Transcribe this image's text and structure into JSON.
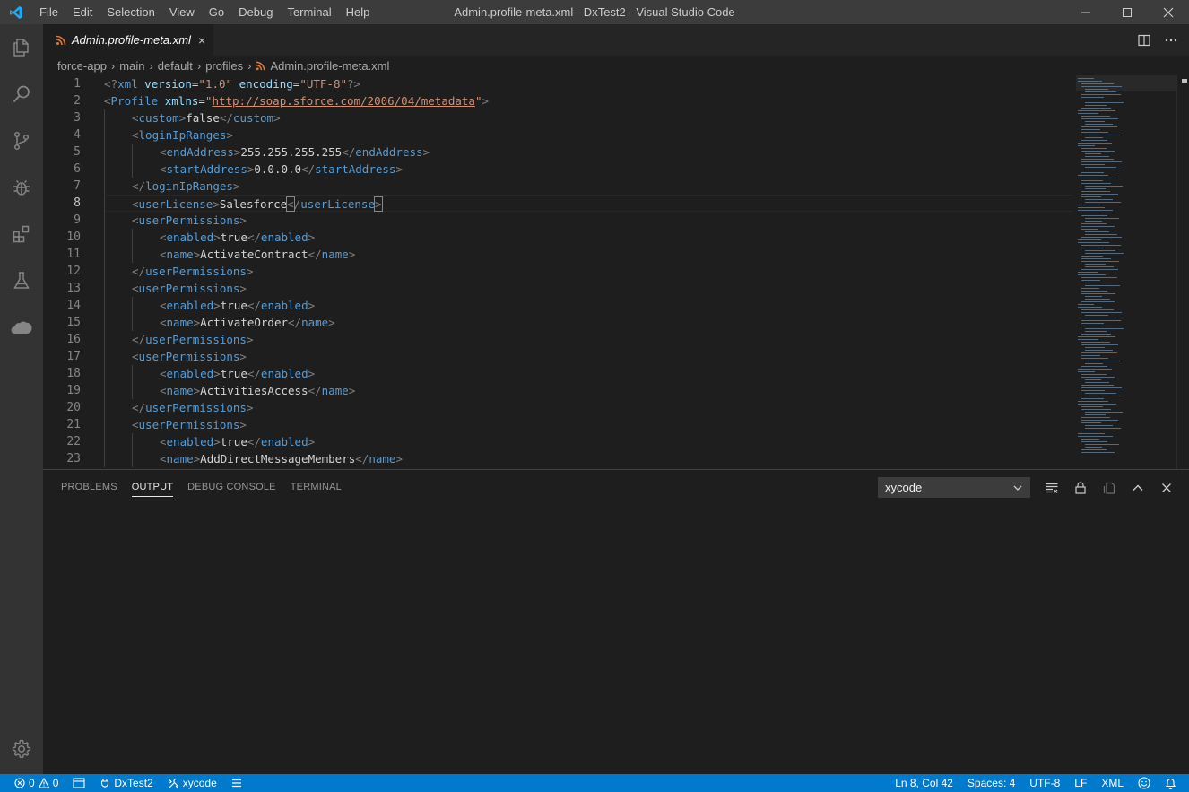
{
  "window": {
    "title": "Admin.profile-meta.xml - DxTest2 - Visual Studio Code",
    "menu": [
      "File",
      "Edit",
      "Selection",
      "View",
      "Go",
      "Debug",
      "Terminal",
      "Help"
    ]
  },
  "activity_bar": {
    "items": [
      "explorer-icon",
      "search-icon",
      "source-control-icon",
      "debug-icon",
      "extensions-icon",
      "test-icon",
      "salesforce-cloud-icon"
    ],
    "bottom": "gear-icon"
  },
  "tab": {
    "name": "Admin.profile-meta.xml",
    "close": "×"
  },
  "breadcrumb": [
    "force-app",
    "main",
    "default",
    "profiles",
    "Admin.profile-meta.xml"
  ],
  "editor": {
    "line_numbers": [
      "1",
      "2",
      "3",
      "4",
      "5",
      "6",
      "7",
      "8",
      "9",
      "10",
      "11",
      "12",
      "13",
      "14",
      "15",
      "16",
      "17",
      "18",
      "19",
      "20",
      "21",
      "22",
      "23"
    ],
    "current_line": 8,
    "lines": [
      {
        "indent": 0,
        "tokens": [
          [
            "punc",
            "<?"
          ],
          [
            "tag",
            "xml"
          ],
          [
            "text",
            " "
          ],
          [
            "attr",
            "version"
          ],
          [
            "text",
            "="
          ],
          [
            "str",
            "\"1.0\""
          ],
          [
            "text",
            " "
          ],
          [
            "attr",
            "encoding"
          ],
          [
            "text",
            "="
          ],
          [
            "str",
            "\"UTF-8\""
          ],
          [
            "punc",
            "?>"
          ]
        ]
      },
      {
        "indent": 0,
        "tokens": [
          [
            "punc",
            "<"
          ],
          [
            "tag",
            "Profile"
          ],
          [
            "text",
            " "
          ],
          [
            "attr",
            "xmlns"
          ],
          [
            "text",
            "="
          ],
          [
            "str",
            "\""
          ],
          [
            "url",
            "http://soap.sforce.com/2006/04/metadata"
          ],
          [
            "str",
            "\""
          ],
          [
            "punc",
            ">"
          ]
        ]
      },
      {
        "indent": 1,
        "tokens": [
          [
            "punc",
            "<"
          ],
          [
            "tag",
            "custom"
          ],
          [
            "punc",
            ">"
          ],
          [
            "text",
            "false"
          ],
          [
            "punc",
            "</"
          ],
          [
            "tag",
            "custom"
          ],
          [
            "punc",
            ">"
          ]
        ]
      },
      {
        "indent": 1,
        "tokens": [
          [
            "punc",
            "<"
          ],
          [
            "tag",
            "loginIpRanges"
          ],
          [
            "punc",
            ">"
          ]
        ]
      },
      {
        "indent": 2,
        "tokens": [
          [
            "punc",
            "<"
          ],
          [
            "tag",
            "endAddress"
          ],
          [
            "punc",
            ">"
          ],
          [
            "text",
            "255.255.255.255"
          ],
          [
            "punc",
            "</"
          ],
          [
            "tag",
            "endAddress"
          ],
          [
            "punc",
            ">"
          ]
        ]
      },
      {
        "indent": 2,
        "tokens": [
          [
            "punc",
            "<"
          ],
          [
            "tag",
            "startAddress"
          ],
          [
            "punc",
            ">"
          ],
          [
            "text",
            "0.0.0.0"
          ],
          [
            "punc",
            "</"
          ],
          [
            "tag",
            "startAddress"
          ],
          [
            "punc",
            ">"
          ]
        ]
      },
      {
        "indent": 1,
        "tokens": [
          [
            "punc",
            "</"
          ],
          [
            "tag",
            "loginIpRanges"
          ],
          [
            "punc",
            ">"
          ]
        ]
      },
      {
        "indent": 1,
        "tokens": [
          [
            "punc",
            "<"
          ],
          [
            "tag",
            "userLicense"
          ],
          [
            "punc",
            ">"
          ],
          [
            "text",
            "Salesforce"
          ],
          [
            "bpunc",
            "<"
          ],
          [
            "punc",
            "/"
          ],
          [
            "tag",
            "userLicense"
          ],
          [
            "bpunc",
            ">"
          ]
        ]
      },
      {
        "indent": 1,
        "tokens": [
          [
            "punc",
            "<"
          ],
          [
            "tag",
            "userPermissions"
          ],
          [
            "punc",
            ">"
          ]
        ]
      },
      {
        "indent": 2,
        "tokens": [
          [
            "punc",
            "<"
          ],
          [
            "tag",
            "enabled"
          ],
          [
            "punc",
            ">"
          ],
          [
            "text",
            "true"
          ],
          [
            "punc",
            "</"
          ],
          [
            "tag",
            "enabled"
          ],
          [
            "punc",
            ">"
          ]
        ]
      },
      {
        "indent": 2,
        "tokens": [
          [
            "punc",
            "<"
          ],
          [
            "tag",
            "name"
          ],
          [
            "punc",
            ">"
          ],
          [
            "text",
            "ActivateContract"
          ],
          [
            "punc",
            "</"
          ],
          [
            "tag",
            "name"
          ],
          [
            "punc",
            ">"
          ]
        ]
      },
      {
        "indent": 1,
        "tokens": [
          [
            "punc",
            "</"
          ],
          [
            "tag",
            "userPermissions"
          ],
          [
            "punc",
            ">"
          ]
        ]
      },
      {
        "indent": 1,
        "tokens": [
          [
            "punc",
            "<"
          ],
          [
            "tag",
            "userPermissions"
          ],
          [
            "punc",
            ">"
          ]
        ]
      },
      {
        "indent": 2,
        "tokens": [
          [
            "punc",
            "<"
          ],
          [
            "tag",
            "enabled"
          ],
          [
            "punc",
            ">"
          ],
          [
            "text",
            "true"
          ],
          [
            "punc",
            "</"
          ],
          [
            "tag",
            "enabled"
          ],
          [
            "punc",
            ">"
          ]
        ]
      },
      {
        "indent": 2,
        "tokens": [
          [
            "punc",
            "<"
          ],
          [
            "tag",
            "name"
          ],
          [
            "punc",
            ">"
          ],
          [
            "text",
            "ActivateOrder"
          ],
          [
            "punc",
            "</"
          ],
          [
            "tag",
            "name"
          ],
          [
            "punc",
            ">"
          ]
        ]
      },
      {
        "indent": 1,
        "tokens": [
          [
            "punc",
            "</"
          ],
          [
            "tag",
            "userPermissions"
          ],
          [
            "punc",
            ">"
          ]
        ]
      },
      {
        "indent": 1,
        "tokens": [
          [
            "punc",
            "<"
          ],
          [
            "tag",
            "userPermissions"
          ],
          [
            "punc",
            ">"
          ]
        ]
      },
      {
        "indent": 2,
        "tokens": [
          [
            "punc",
            "<"
          ],
          [
            "tag",
            "enabled"
          ],
          [
            "punc",
            ">"
          ],
          [
            "text",
            "true"
          ],
          [
            "punc",
            "</"
          ],
          [
            "tag",
            "enabled"
          ],
          [
            "punc",
            ">"
          ]
        ]
      },
      {
        "indent": 2,
        "tokens": [
          [
            "punc",
            "<"
          ],
          [
            "tag",
            "name"
          ],
          [
            "punc",
            ">"
          ],
          [
            "text",
            "ActivitiesAccess"
          ],
          [
            "punc",
            "</"
          ],
          [
            "tag",
            "name"
          ],
          [
            "punc",
            ">"
          ]
        ]
      },
      {
        "indent": 1,
        "tokens": [
          [
            "punc",
            "</"
          ],
          [
            "tag",
            "userPermissions"
          ],
          [
            "punc",
            ">"
          ]
        ]
      },
      {
        "indent": 1,
        "tokens": [
          [
            "punc",
            "<"
          ],
          [
            "tag",
            "userPermissions"
          ],
          [
            "punc",
            ">"
          ]
        ]
      },
      {
        "indent": 2,
        "tokens": [
          [
            "punc",
            "<"
          ],
          [
            "tag",
            "enabled"
          ],
          [
            "punc",
            ">"
          ],
          [
            "text",
            "true"
          ],
          [
            "punc",
            "</"
          ],
          [
            "tag",
            "enabled"
          ],
          [
            "punc",
            ">"
          ]
        ]
      },
      {
        "indent": 2,
        "tokens": [
          [
            "punc",
            "<"
          ],
          [
            "tag",
            "name"
          ],
          [
            "punc",
            ">"
          ],
          [
            "text",
            "AddDirectMessageMembers"
          ],
          [
            "punc",
            "</"
          ],
          [
            "tag",
            "name"
          ],
          [
            "punc",
            ">"
          ]
        ]
      }
    ]
  },
  "panel": {
    "tabs": [
      "PROBLEMS",
      "OUTPUT",
      "DEBUG CONSOLE",
      "TERMINAL"
    ],
    "active_tab": "OUTPUT",
    "output_channel": "xycode",
    "actions": [
      "clear-output-icon",
      "lock-icon",
      "open-log-icon",
      "maximize-panel-icon",
      "close-panel-icon"
    ]
  },
  "status_bar": {
    "errors": "0",
    "warnings": "0",
    "org": "DxTest2",
    "tool": "xycode",
    "position": "Ln 8, Col 42",
    "spaces": "Spaces: 4",
    "encoding": "UTF-8",
    "eol": "LF",
    "language": "XML"
  },
  "colors": {
    "accent": "#007acc",
    "tag": "#569cd6",
    "attribute": "#9cdcfe",
    "string": "#ce9178",
    "punctuation": "#808080"
  }
}
